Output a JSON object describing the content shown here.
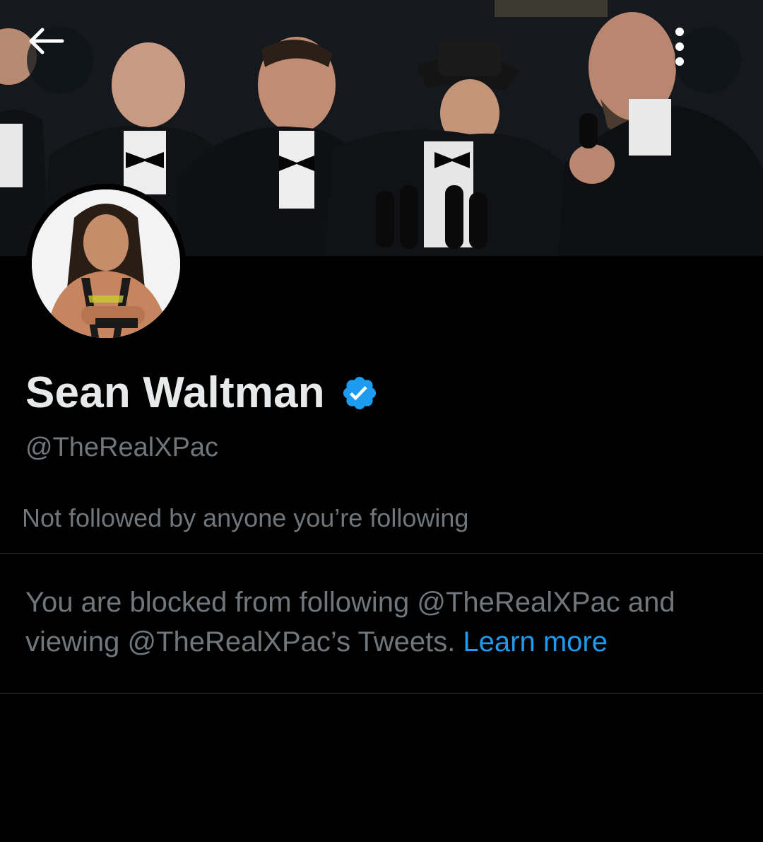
{
  "header": {
    "back_icon": "arrow-left-icon",
    "more_icon": "more-vertical-icon",
    "banner_image": "group-photo-banner"
  },
  "profile": {
    "display_name": "Sean Waltman",
    "verified_icon": "verified-badge-icon",
    "handle": "@TheRealXPac",
    "followers_note": "Not followed by anyone you’re following"
  },
  "blocked_notice": {
    "text": "You are blocked from following @TheRealXPac and viewing @TheRealXPac’s Tweets. ",
    "link_text": "Learn more"
  },
  "colors": {
    "background": "#000000",
    "primary_text": "#e7e9ea",
    "secondary_text": "#71767b",
    "link": "#1d9bf0",
    "verified": "#1d9bf0",
    "divider": "#2f3336"
  }
}
